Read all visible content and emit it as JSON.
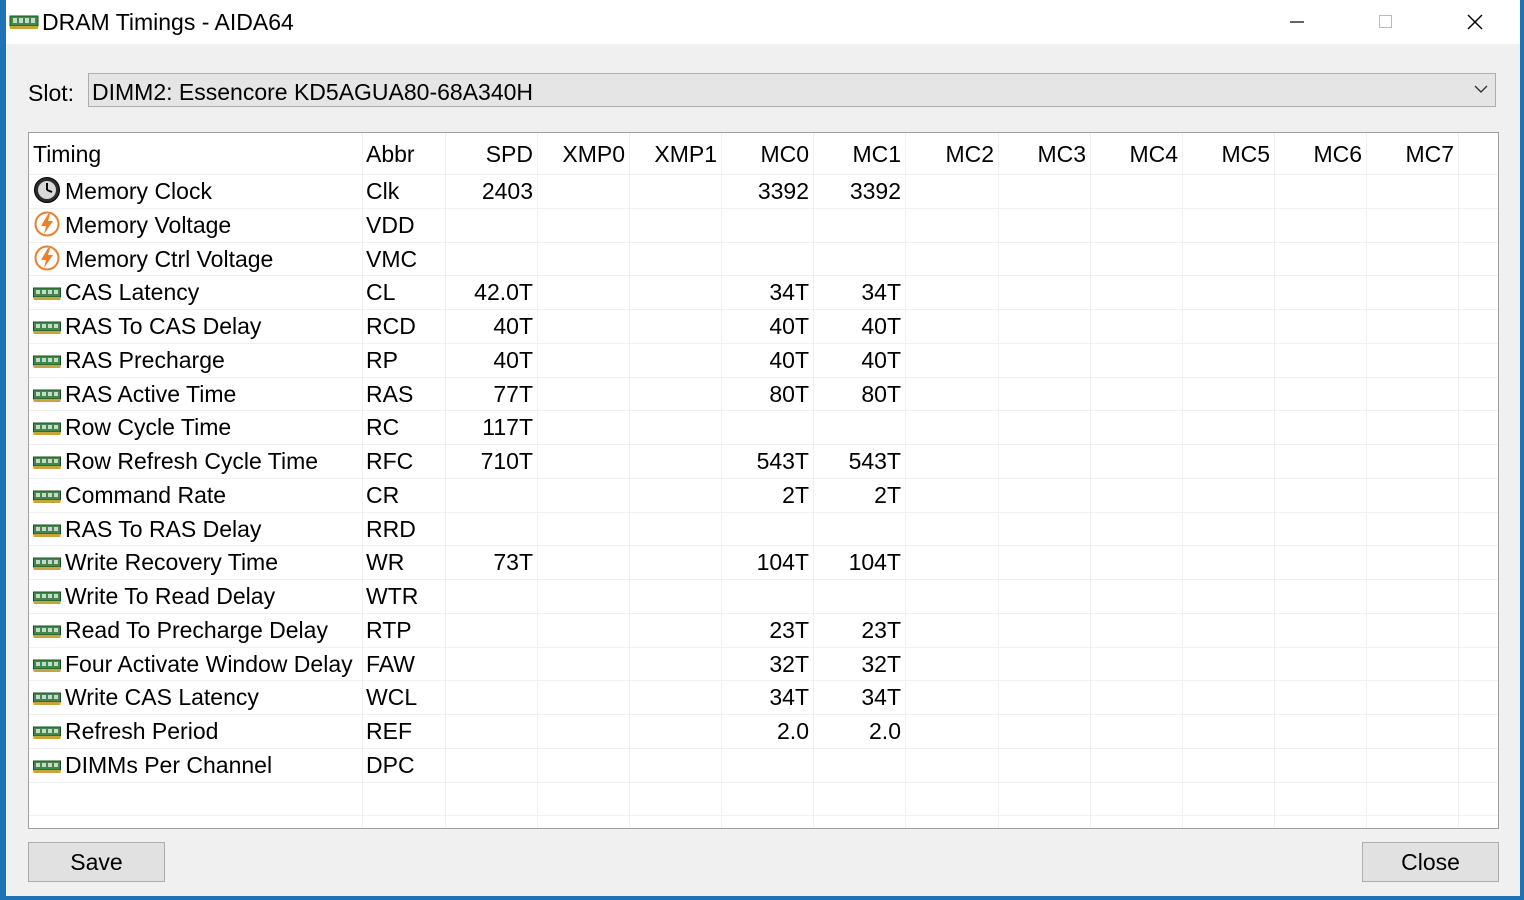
{
  "window": {
    "title": "DRAM Timings - AIDA64",
    "app_icon": "memory-module-icon",
    "controls": [
      "minimize-icon",
      "maximize-icon",
      "close-icon"
    ]
  },
  "slot": {
    "label": "Slot:",
    "value": "DIMM2: Essencore KD5AGUA80-68A340H"
  },
  "table": {
    "headers": [
      "Timing",
      "Abbr",
      "SPD",
      "XMP0",
      "XMP1",
      "MC0",
      "MC1",
      "MC2",
      "MC3",
      "MC4",
      "MC5",
      "MC6",
      "MC7"
    ],
    "rows": [
      {
        "icon": "clock-icon",
        "timing": "Memory Clock",
        "abbr": "Clk",
        "spd": "2403",
        "xmp0": "",
        "xmp1": "",
        "mc0": "3392",
        "mc1": "3392"
      },
      {
        "icon": "voltage-icon",
        "timing": "Memory Voltage",
        "abbr": "VDD",
        "spd": "",
        "xmp0": "",
        "xmp1": "",
        "mc0": "",
        "mc1": ""
      },
      {
        "icon": "voltage-icon",
        "timing": "Memory Ctrl Voltage",
        "abbr": "VMC",
        "spd": "",
        "xmp0": "",
        "xmp1": "",
        "mc0": "",
        "mc1": ""
      },
      {
        "icon": "memory-module-icon",
        "timing": "CAS Latency",
        "abbr": "CL",
        "spd": "42.0T",
        "xmp0": "",
        "xmp1": "",
        "mc0": "34T",
        "mc1": "34T"
      },
      {
        "icon": "memory-module-icon",
        "timing": "RAS To CAS Delay",
        "abbr": "RCD",
        "spd": "40T",
        "xmp0": "",
        "xmp1": "",
        "mc0": "40T",
        "mc1": "40T"
      },
      {
        "icon": "memory-module-icon",
        "timing": "RAS Precharge",
        "abbr": "RP",
        "spd": "40T",
        "xmp0": "",
        "xmp1": "",
        "mc0": "40T",
        "mc1": "40T"
      },
      {
        "icon": "memory-module-icon",
        "timing": "RAS Active Time",
        "abbr": "RAS",
        "spd": "77T",
        "xmp0": "",
        "xmp1": "",
        "mc0": "80T",
        "mc1": "80T"
      },
      {
        "icon": "memory-module-icon",
        "timing": "Row Cycle Time",
        "abbr": "RC",
        "spd": "117T",
        "xmp0": "",
        "xmp1": "",
        "mc0": "",
        "mc1": ""
      },
      {
        "icon": "memory-module-icon",
        "timing": "Row Refresh Cycle Time",
        "abbr": "RFC",
        "spd": "710T",
        "xmp0": "",
        "xmp1": "",
        "mc0": "543T",
        "mc1": "543T"
      },
      {
        "icon": "memory-module-icon",
        "timing": "Command Rate",
        "abbr": "CR",
        "spd": "",
        "xmp0": "",
        "xmp1": "",
        "mc0": "2T",
        "mc1": "2T"
      },
      {
        "icon": "memory-module-icon",
        "timing": "RAS To RAS Delay",
        "abbr": "RRD",
        "spd": "",
        "xmp0": "",
        "xmp1": "",
        "mc0": "",
        "mc1": ""
      },
      {
        "icon": "memory-module-icon",
        "timing": "Write Recovery Time",
        "abbr": "WR",
        "spd": "73T",
        "xmp0": "",
        "xmp1": "",
        "mc0": "104T",
        "mc1": "104T"
      },
      {
        "icon": "memory-module-icon",
        "timing": "Write To Read Delay",
        "abbr": "WTR",
        "spd": "",
        "xmp0": "",
        "xmp1": "",
        "mc0": "",
        "mc1": ""
      },
      {
        "icon": "memory-module-icon",
        "timing": "Read To Precharge Delay",
        "abbr": "RTP",
        "spd": "",
        "xmp0": "",
        "xmp1": "",
        "mc0": "23T",
        "mc1": "23T"
      },
      {
        "icon": "memory-module-icon",
        "timing": "Four Activate Window Delay",
        "abbr": "FAW",
        "spd": "",
        "xmp0": "",
        "xmp1": "",
        "mc0": "32T",
        "mc1": "32T"
      },
      {
        "icon": "memory-module-icon",
        "timing": "Write CAS Latency",
        "abbr": "WCL",
        "spd": "",
        "xmp0": "",
        "xmp1": "",
        "mc0": "34T",
        "mc1": "34T"
      },
      {
        "icon": "memory-module-icon",
        "timing": "Refresh Period",
        "abbr": "REF",
        "spd": "",
        "xmp0": "",
        "xmp1": "",
        "mc0": "2.0",
        "mc1": "2.0"
      },
      {
        "icon": "memory-module-icon",
        "timing": "DIMMs Per Channel",
        "abbr": "DPC",
        "spd": "",
        "xmp0": "",
        "xmp1": "",
        "mc0": "",
        "mc1": ""
      }
    ]
  },
  "buttons": {
    "save_label": "Save",
    "close_label": "Close"
  },
  "colors": {
    "accent_orange": "#e8822e",
    "module_green": "#3f8a4a"
  }
}
